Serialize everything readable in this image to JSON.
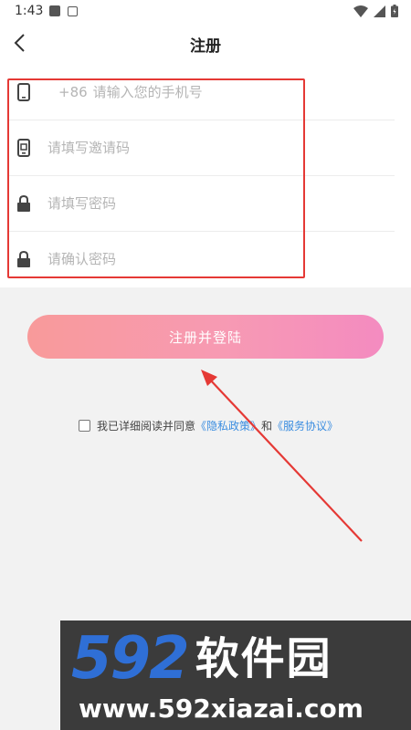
{
  "status_bar": {
    "time": "1:43",
    "icons": [
      "notification-square-icon",
      "a-notification-icon",
      "wifi-icon",
      "signal-icon",
      "battery-icon"
    ]
  },
  "header": {
    "title": "注册",
    "back_icon": "chevron-left-icon"
  },
  "form": {
    "phone": {
      "prefix": "+86",
      "placeholder": "请输入您的手机号",
      "icon": "phone-icon"
    },
    "invite_code": {
      "placeholder": "请填写邀请码",
      "icon": "invite-code-icon"
    },
    "password": {
      "placeholder": "请填写密码",
      "icon": "lock-icon"
    },
    "confirm_password": {
      "placeholder": "请确认密码",
      "icon": "lock-icon"
    }
  },
  "register_button": {
    "label": "注册并登陆"
  },
  "agreement": {
    "checked": false,
    "text": "我已详细阅读并同意",
    "privacy_link": "《隐私政策》",
    "connector": "和",
    "service_link": "《服务协议》"
  },
  "watermark": {
    "numbers": "592",
    "brand": "软件园",
    "url": "www.592xiazai.com"
  },
  "colors": {
    "highlight": "#e53935",
    "arrow": "#e53935",
    "link": "#3b8de0",
    "button_gradient_start": "#f89a9a",
    "button_gradient_end": "#f48bc0"
  }
}
